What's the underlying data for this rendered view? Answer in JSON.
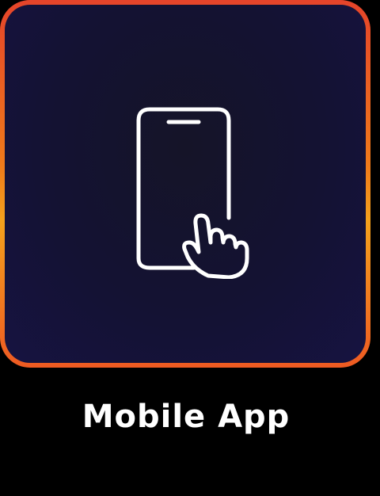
{
  "tile": {
    "label": "Mobile App",
    "icon": "phone-tap-icon",
    "colors": {
      "border_top": "#e5442a",
      "border_mid": "#f4a11c",
      "background": "#141233",
      "icon": "#ffffff",
      "label": "#ffffff"
    }
  }
}
